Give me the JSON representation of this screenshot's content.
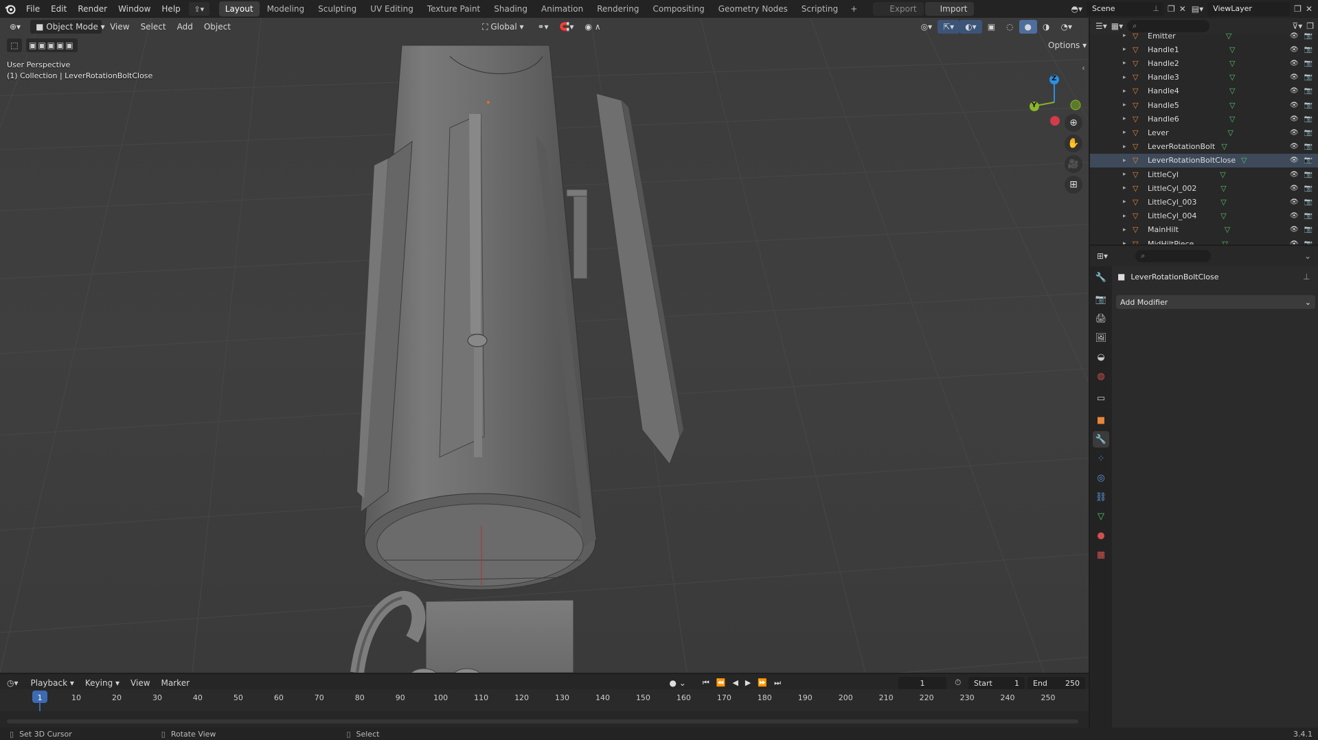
{
  "app": {
    "menus": [
      "File",
      "Edit",
      "Render",
      "Window",
      "Help"
    ],
    "workspaces": [
      {
        "label": "Layout",
        "active": true
      },
      {
        "label": "Modeling"
      },
      {
        "label": "Sculpting"
      },
      {
        "label": "UV Editing"
      },
      {
        "label": "Texture Paint"
      },
      {
        "label": "Shading"
      },
      {
        "label": "Animation"
      },
      {
        "label": "Rendering"
      },
      {
        "label": "Compositing"
      },
      {
        "label": "Geometry Nodes"
      },
      {
        "label": "Scripting"
      }
    ],
    "add_workspace": "+",
    "export_label": "Export",
    "import_label": "Import",
    "scene_name": "Scene",
    "view_layer": "ViewLayer",
    "version": "3.4.1"
  },
  "viewport": {
    "mode": "Object Mode",
    "menus": [
      "View",
      "Select",
      "Add",
      "Object"
    ],
    "transform_orientation": "Global",
    "options_label": "Options",
    "perspective_label": "User Perspective",
    "collection_label": "(1) Collection | LeverRotationBoltClose",
    "gizmo_axes": {
      "z": "Z",
      "y": "Y"
    },
    "colors": {
      "x": "#d33b4d",
      "y": "#8ab62b",
      "z": "#2c8fe0"
    }
  },
  "outliner": {
    "items": [
      {
        "name": "Emitter"
      },
      {
        "name": "Handle1"
      },
      {
        "name": "Handle2"
      },
      {
        "name": "Handle3"
      },
      {
        "name": "Handle4"
      },
      {
        "name": "Handle5"
      },
      {
        "name": "Handle6"
      },
      {
        "name": "Lever"
      },
      {
        "name": "LeverRotationBolt"
      },
      {
        "name": "LeverRotationBoltClose",
        "selected": true
      },
      {
        "name": "LittleCyl"
      },
      {
        "name": "LittleCyl_002"
      },
      {
        "name": "LittleCyl_003"
      },
      {
        "name": "LittleCyl_004"
      },
      {
        "name": "MainHilt"
      },
      {
        "name": "MidHiltPiece"
      }
    ]
  },
  "properties": {
    "object_name": "LeverRotationBoltClose",
    "add_modifier_label": "Add Modifier"
  },
  "timeline": {
    "menus": [
      "Playback",
      "Keying",
      "View",
      "Marker"
    ],
    "current_frame": "1",
    "start_label": "Start",
    "start_value": "1",
    "end_label": "End",
    "end_value": "250",
    "ticks": [
      "1",
      "10",
      "20",
      "30",
      "40",
      "50",
      "60",
      "70",
      "80",
      "90",
      "100",
      "110",
      "120",
      "130",
      "140",
      "150",
      "160",
      "170",
      "180",
      "190",
      "200",
      "210",
      "220",
      "230",
      "240",
      "250"
    ]
  },
  "statusbar": {
    "left_hint": "Set 3D Cursor",
    "middle_hint": "Rotate View",
    "right_hint": "Select"
  }
}
